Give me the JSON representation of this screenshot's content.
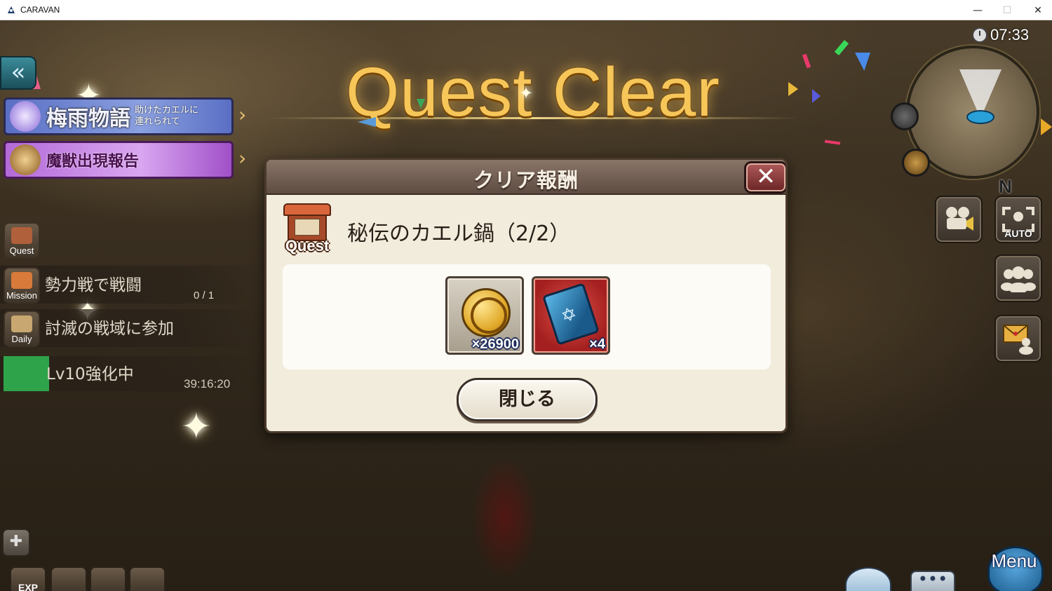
{
  "window": {
    "title": "CARAVAN",
    "minimize": "—",
    "maximize": "☐",
    "close": "✕"
  },
  "banner": {
    "title": "Quest Clear"
  },
  "left_panel": {
    "back_arrow": "«",
    "event_banner": {
      "main": "梅雨物語",
      "sub": "助けたカエルに\n連れられて"
    },
    "beast_banner": {
      "main": "魔獣出現報告"
    },
    "arrow": "›",
    "quest_icon_label": "Quest",
    "mission": {
      "icon_label": "Mission",
      "text": "勢力戦で戦闘",
      "count": "0 / 1"
    },
    "daily": {
      "icon_label": "Daily",
      "text": "討滅の戦域に参加"
    },
    "enhance": {
      "text": "Lv10強化中",
      "timer": "39:16:20"
    },
    "plus": "✚",
    "bottom_icons": [
      "EXP",
      "",
      "",
      ""
    ]
  },
  "hud": {
    "time": "07:33",
    "compass": "N",
    "auto_label": "AUTO",
    "menu_label": "Menu",
    "chat_label": "•••"
  },
  "dialog": {
    "title": "クリア報酬",
    "close_x": "✕",
    "quest_label": "Quest",
    "quest_name": "秘伝のカエル鍋（2/2）",
    "rewards": [
      {
        "icon": "gil-coin-icon",
        "quantity": "×26900"
      },
      {
        "icon": "blue-book-icon",
        "quantity": "×4"
      }
    ],
    "close_button": "閉じる"
  },
  "colors": {
    "title_gold": "#f7c659",
    "dialog_bg": "#f2ecdd",
    "header_brown": "#6e5a4e",
    "close_red": "#8a3434",
    "item_red": "#c43a34"
  }
}
